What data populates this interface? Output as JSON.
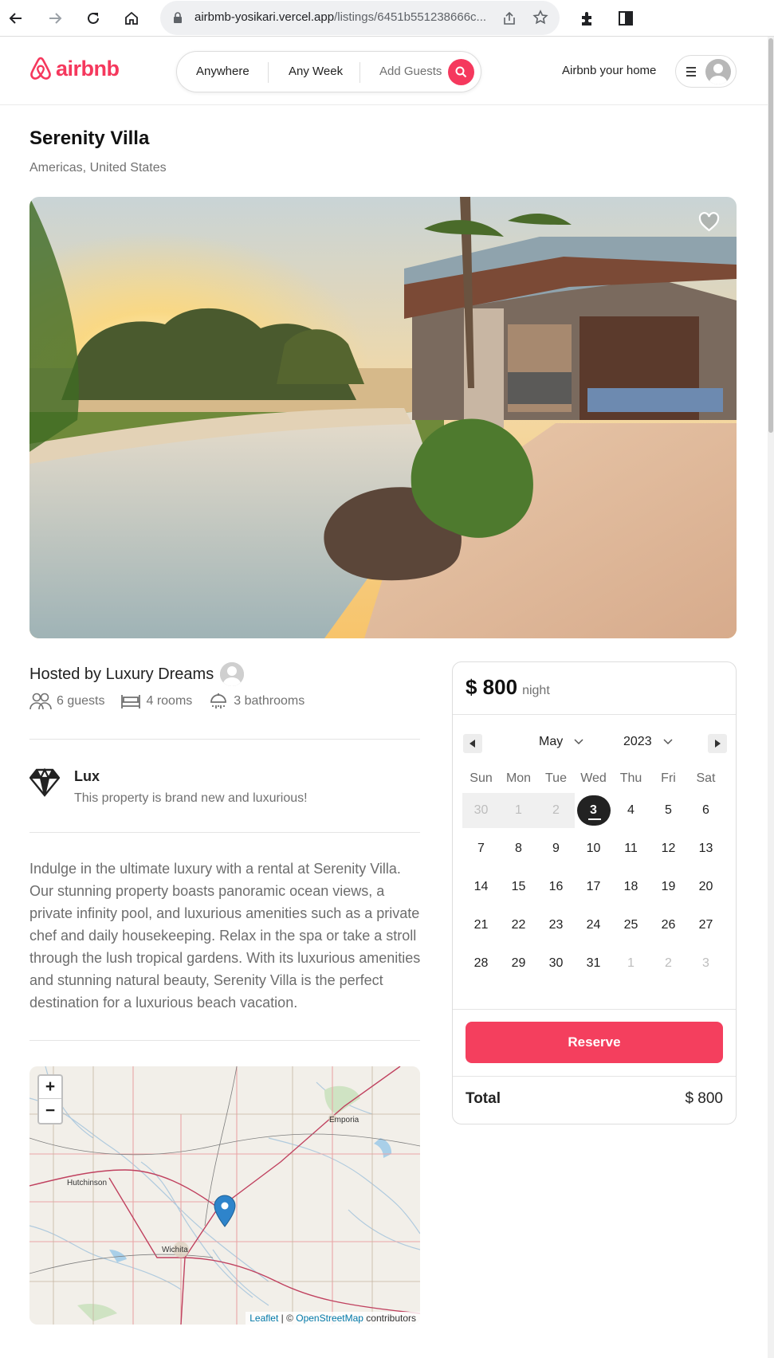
{
  "browser": {
    "url_domain": "airbmb-yosikari.vercel.app",
    "url_path": "/listings/6451b551238666c..."
  },
  "header": {
    "logo_text": "airbnb",
    "search": {
      "where": "Anywhere",
      "when": "Any Week",
      "who": "Add Guests"
    },
    "host_link": "Airbnb your home"
  },
  "listing": {
    "title": "Serenity Villa",
    "location": "Americas, United States",
    "host_line": "Hosted by Luxury Dreams",
    "stats": {
      "guests": "6 guests",
      "rooms": "4 rooms",
      "bathrooms": "3 bathrooms"
    },
    "category": {
      "name": "Lux",
      "description": "This property is brand new and luxurious!",
      "icon": "diamond-icon"
    },
    "description": "Indulge in the ultimate luxury with a rental at Serenity Villa. Our stunning property boasts panoramic ocean views, a private infinity pool, and luxurious amenities such as a private chef and daily housekeeping. Relax in the spa or take a stroll through the lush tropical gardens. With its luxurious amenities and stunning natural beauty, Serenity Villa is the perfect destination for a luxurious beach vacation."
  },
  "map": {
    "zoom_in": "+",
    "zoom_out": "−",
    "places": [
      "Emporia",
      "Hutchinson",
      "Wichita"
    ],
    "attribution": {
      "leaflet": "Leaflet",
      "sep": " | © ",
      "osm": "OpenStreetMap",
      "tail": " contributors"
    }
  },
  "booking": {
    "price": "$ 800",
    "per": "night",
    "calendar": {
      "month": "May",
      "year": "2023",
      "weekdays": [
        "Sun",
        "Mon",
        "Tue",
        "Wed",
        "Thu",
        "Fri",
        "Sat"
      ],
      "weeks": [
        [
          {
            "d": "30",
            "s": "past"
          },
          {
            "d": "1",
            "s": "past"
          },
          {
            "d": "2",
            "s": "past"
          },
          {
            "d": "3",
            "s": "sel"
          },
          {
            "d": "4",
            "s": ""
          },
          {
            "d": "5",
            "s": ""
          },
          {
            "d": "6",
            "s": ""
          }
        ],
        [
          {
            "d": "7",
            "s": ""
          },
          {
            "d": "8",
            "s": ""
          },
          {
            "d": "9",
            "s": ""
          },
          {
            "d": "10",
            "s": ""
          },
          {
            "d": "11",
            "s": ""
          },
          {
            "d": "12",
            "s": ""
          },
          {
            "d": "13",
            "s": ""
          }
        ],
        [
          {
            "d": "14",
            "s": ""
          },
          {
            "d": "15",
            "s": ""
          },
          {
            "d": "16",
            "s": ""
          },
          {
            "d": "17",
            "s": ""
          },
          {
            "d": "18",
            "s": ""
          },
          {
            "d": "19",
            "s": ""
          },
          {
            "d": "20",
            "s": ""
          }
        ],
        [
          {
            "d": "21",
            "s": ""
          },
          {
            "d": "22",
            "s": ""
          },
          {
            "d": "23",
            "s": ""
          },
          {
            "d": "24",
            "s": ""
          },
          {
            "d": "25",
            "s": ""
          },
          {
            "d": "26",
            "s": ""
          },
          {
            "d": "27",
            "s": ""
          }
        ],
        [
          {
            "d": "28",
            "s": ""
          },
          {
            "d": "29",
            "s": ""
          },
          {
            "d": "30",
            "s": ""
          },
          {
            "d": "31",
            "s": ""
          },
          {
            "d": "1",
            "s": "out"
          },
          {
            "d": "2",
            "s": "out"
          },
          {
            "d": "3",
            "s": "out"
          }
        ]
      ]
    },
    "reserve_label": "Reserve",
    "total_label": "Total",
    "total_value": "$ 800"
  },
  "colors": {
    "brand": "#f5385d",
    "reserve": "#f43f5e",
    "text": "#222222",
    "muted": "#717171"
  }
}
